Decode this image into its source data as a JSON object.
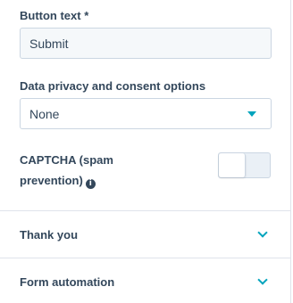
{
  "button_text": {
    "label": "Button text *",
    "value": "Submit"
  },
  "privacy": {
    "label": "Data privacy and consent options",
    "selected": "None"
  },
  "captcha": {
    "label": "CAPTCHA (spam prevention)",
    "info_icon": "i",
    "enabled": false
  },
  "sections": [
    {
      "title": "Thank you"
    },
    {
      "title": "Form automation"
    }
  ],
  "colors": {
    "accent": "#00a4bd",
    "text": "#33475b",
    "border": "#cbd6e2"
  }
}
